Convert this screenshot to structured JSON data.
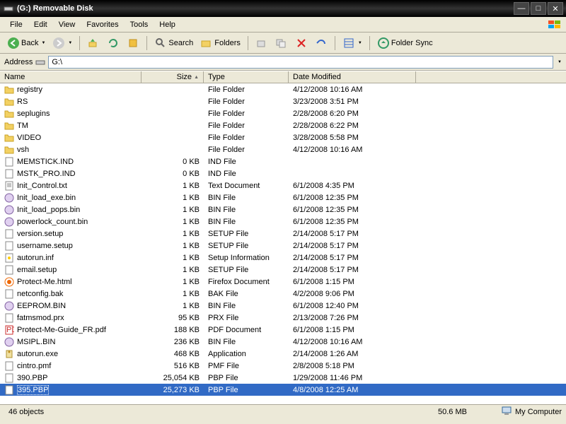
{
  "window": {
    "title": "(G:) Removable Disk"
  },
  "menu": {
    "file": "File",
    "edit": "Edit",
    "view": "View",
    "favorites": "Favorites",
    "tools": "Tools",
    "help": "Help"
  },
  "toolbar": {
    "back": "Back",
    "search": "Search",
    "folders": "Folders",
    "foldersync": "Folder Sync"
  },
  "address": {
    "label": "Address",
    "value": "G:\\"
  },
  "columns": {
    "name": "Name",
    "size": "Size",
    "type": "Type",
    "date": "Date Modified"
  },
  "files": [
    {
      "icon": "folder",
      "name": "registry",
      "size": "",
      "type": "File Folder",
      "date": "4/12/2008 10:16 AM"
    },
    {
      "icon": "folder",
      "name": "RS",
      "size": "",
      "type": "File Folder",
      "date": "3/23/2008 3:51 PM"
    },
    {
      "icon": "folder",
      "name": "seplugins",
      "size": "",
      "type": "File Folder",
      "date": "2/28/2008 6:20 PM"
    },
    {
      "icon": "folder",
      "name": "TM",
      "size": "",
      "type": "File Folder",
      "date": "2/28/2008 6:22 PM"
    },
    {
      "icon": "folder",
      "name": "VIDEO",
      "size": "",
      "type": "File Folder",
      "date": "3/28/2008 5:58 PM"
    },
    {
      "icon": "folder",
      "name": "vsh",
      "size": "",
      "type": "File Folder",
      "date": "4/12/2008 10:16 AM"
    },
    {
      "icon": "file",
      "name": "MEMSTICK.IND",
      "size": "0 KB",
      "type": "IND File",
      "date": ""
    },
    {
      "icon": "file",
      "name": "MSTK_PRO.IND",
      "size": "0 KB",
      "type": "IND File",
      "date": ""
    },
    {
      "icon": "txt",
      "name": "Init_Control.txt",
      "size": "1 KB",
      "type": "Text Document",
      "date": "6/1/2008 4:35 PM"
    },
    {
      "icon": "bin",
      "name": "Init_load_exe.bin",
      "size": "1 KB",
      "type": "BIN File",
      "date": "6/1/2008 12:35 PM"
    },
    {
      "icon": "bin",
      "name": "Init_load_pops.bin",
      "size": "1 KB",
      "type": "BIN File",
      "date": "6/1/2008 12:35 PM"
    },
    {
      "icon": "bin",
      "name": "powerlock_count.bin",
      "size": "1 KB",
      "type": "BIN File",
      "date": "6/1/2008 12:35 PM"
    },
    {
      "icon": "file",
      "name": "version.setup",
      "size": "1 KB",
      "type": "SETUP File",
      "date": "2/14/2008 5:17 PM"
    },
    {
      "icon": "file",
      "name": "username.setup",
      "size": "1 KB",
      "type": "SETUP File",
      "date": "2/14/2008 5:17 PM"
    },
    {
      "icon": "inf",
      "name": "autorun.inf",
      "size": "1 KB",
      "type": "Setup Information",
      "date": "2/14/2008 5:17 PM"
    },
    {
      "icon": "file",
      "name": "email.setup",
      "size": "1 KB",
      "type": "SETUP File",
      "date": "2/14/2008 5:17 PM"
    },
    {
      "icon": "html",
      "name": "Protect-Me.html",
      "size": "1 KB",
      "type": "Firefox Document",
      "date": "6/1/2008 1:15 PM"
    },
    {
      "icon": "file",
      "name": "netconfig.bak",
      "size": "1 KB",
      "type": "BAK File",
      "date": "4/2/2008 9:06 PM"
    },
    {
      "icon": "bin",
      "name": "EEPROM.BIN",
      "size": "1 KB",
      "type": "BIN File",
      "date": "6/1/2008 12:40 PM"
    },
    {
      "icon": "file",
      "name": "fatmsmod.prx",
      "size": "95 KB",
      "type": "PRX File",
      "date": "2/13/2008 7:26 PM"
    },
    {
      "icon": "pdf",
      "name": "Protect-Me-Guide_FR.pdf",
      "size": "188 KB",
      "type": "PDF Document",
      "date": "6/1/2008 1:15 PM"
    },
    {
      "icon": "bin",
      "name": "MSIPL.BIN",
      "size": "236 KB",
      "type": "BIN File",
      "date": "4/12/2008 10:16 AM"
    },
    {
      "icon": "exe",
      "name": "autorun.exe",
      "size": "468 KB",
      "type": "Application",
      "date": "2/14/2008 1:26 AM"
    },
    {
      "icon": "file",
      "name": "cintro.pmf",
      "size": "516 KB",
      "type": "PMF File",
      "date": "2/8/2008 5:18 PM"
    },
    {
      "icon": "file",
      "name": "390.PBP",
      "size": "25,054 KB",
      "type": "PBP File",
      "date": "1/29/2008 11:46 PM"
    },
    {
      "icon": "file",
      "name": "395.PBP",
      "size": "25,273 KB",
      "type": "PBP File",
      "date": "4/8/2008 12:25 AM",
      "selected": true
    }
  ],
  "status": {
    "objects": "46 objects",
    "size": "50.6 MB",
    "location": "My Computer"
  }
}
